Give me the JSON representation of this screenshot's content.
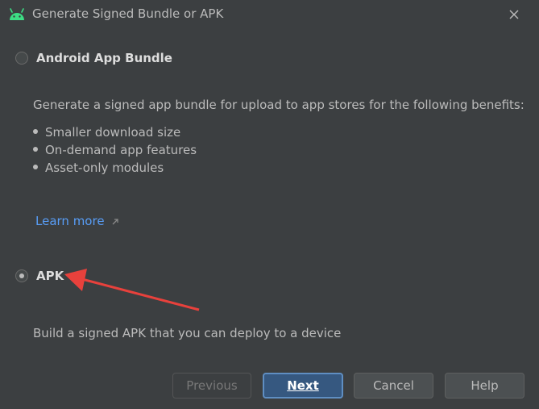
{
  "window": {
    "title": "Generate Signed Bundle or APK",
    "app_icon": "android-icon",
    "close_icon": "close-icon"
  },
  "options": {
    "bundle": {
      "label": "Android App Bundle",
      "selected": false,
      "description": "Generate a signed app bundle for upload to app stores for the following benefits:",
      "benefits": [
        "Smaller download size",
        "On-demand app features",
        "Asset-only modules"
      ],
      "learn_more": "Learn more"
    },
    "apk": {
      "label": "APK",
      "selected": true,
      "description": "Build a signed APK that you can deploy to a device"
    }
  },
  "buttons": {
    "previous": "Previous",
    "next": "Next",
    "cancel": "Cancel",
    "help": "Help"
  },
  "colors": {
    "background": "#3c3f41",
    "link": "#589df6",
    "primary_button": "#365880",
    "annotation_arrow": "#e8413c"
  }
}
